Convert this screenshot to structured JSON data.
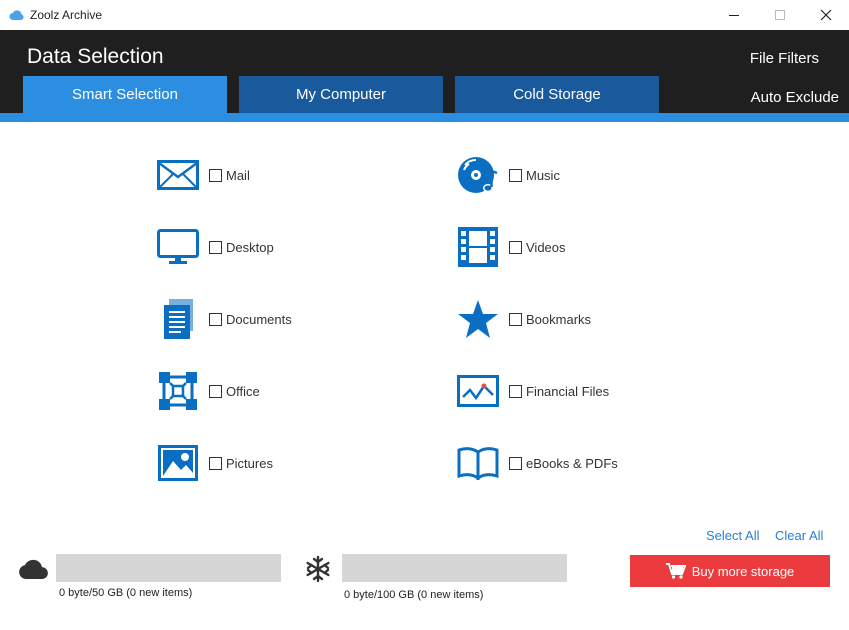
{
  "window": {
    "title": "Zoolz Archive"
  },
  "header": {
    "title": "Data Selection",
    "file_filters": "File Filters",
    "auto_exclude": "Auto Exclude",
    "tabs": [
      {
        "label": "Smart Selection",
        "active": true
      },
      {
        "label": "My Computer",
        "active": false
      },
      {
        "label": "Cold Storage",
        "active": false
      }
    ]
  },
  "categories": {
    "left": [
      {
        "label": "Mail",
        "icon": "mail-icon",
        "checked": false
      },
      {
        "label": "Desktop",
        "icon": "monitor-icon",
        "checked": false
      },
      {
        "label": "Documents",
        "icon": "documents-icon",
        "checked": false
      },
      {
        "label": "Office",
        "icon": "office-icon",
        "checked": false
      },
      {
        "label": "Pictures",
        "icon": "picture-icon",
        "checked": false
      }
    ],
    "right": [
      {
        "label": "Music",
        "icon": "music-icon",
        "checked": false
      },
      {
        "label": "Videos",
        "icon": "film-icon",
        "checked": false
      },
      {
        "label": "Bookmarks",
        "icon": "star-icon",
        "checked": false
      },
      {
        "label": "Financial Files",
        "icon": "chart-icon",
        "checked": false
      },
      {
        "label": "eBooks & PDFs",
        "icon": "book-icon",
        "checked": false
      }
    ]
  },
  "actions": {
    "select_all": "Select All",
    "clear_all": "Clear All",
    "buy_more": "Buy more storage"
  },
  "storage": {
    "cloud": {
      "text": "0 byte/50 GB (0 new items)",
      "used_fraction": 0
    },
    "cold": {
      "text": "0 byte/100 GB (0 new items)",
      "used_fraction": 0
    }
  },
  "colors": {
    "accent": "#2b8ee0",
    "tab_inactive": "#185a9b",
    "header_bg": "#1f1f1f",
    "icon_blue": "#0a6fc2",
    "buy_red": "#ec3b3e"
  }
}
